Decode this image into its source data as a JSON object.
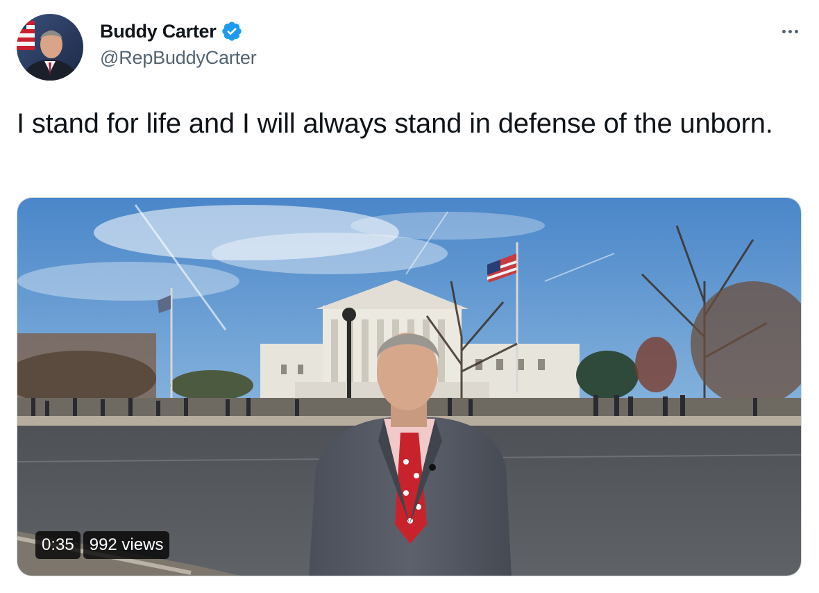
{
  "author": {
    "display_name": "Buddy Carter",
    "handle": "@RepBuddyCarter",
    "verified": true,
    "avatar_icon": "profile-photo",
    "verified_icon": "verified-badge-icon",
    "more_icon": "more-options-icon"
  },
  "tweet": {
    "text": "I stand for life and I will always stand in defense of the unborn."
  },
  "media": {
    "type": "video",
    "duration": "0:35",
    "views": "992 views"
  },
  "colors": {
    "text_primary": "#0f1419",
    "text_secondary": "#536471",
    "verified_blue": "#1d9bf0",
    "border": "#cfd9de"
  }
}
